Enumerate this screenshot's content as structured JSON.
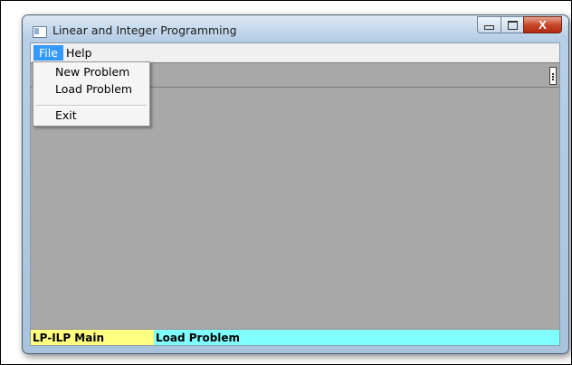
{
  "window": {
    "title": "Linear and Integer Programming",
    "close_glyph": "X"
  },
  "menubar": {
    "items": [
      {
        "label": "File",
        "active": true
      },
      {
        "label": "Help",
        "active": false
      }
    ]
  },
  "file_menu": {
    "items": [
      "New Problem",
      "Load Problem",
      "Exit"
    ]
  },
  "statusbar": {
    "left_text": "LP-ILP Main",
    "right_text": "Load Problem",
    "left_color": "#ffff80",
    "right_color": "#80ffff"
  },
  "icons": [
    "app-icon",
    "minimize-icon",
    "maximize-icon",
    "close-icon",
    "toolbar-grip-icon"
  ]
}
